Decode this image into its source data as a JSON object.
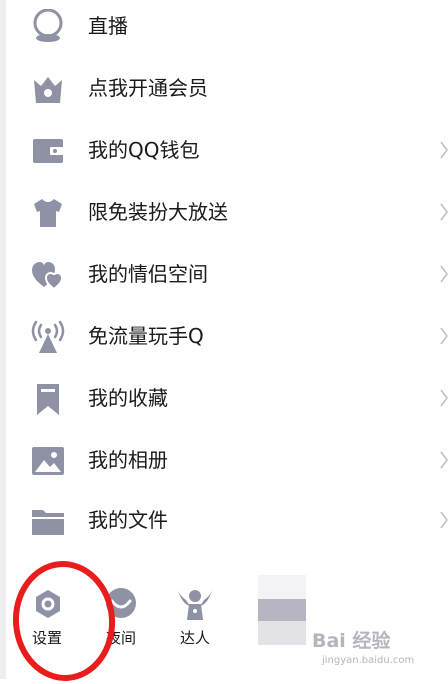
{
  "colors": {
    "icon": "#8f91a5",
    "chevron": "#c4c4c8",
    "highlight": "#ea1d1d"
  },
  "menu": {
    "items": [
      {
        "label": "直播",
        "icon": "live-icon"
      },
      {
        "label": "点我开通会员",
        "icon": "vip-crown-icon"
      },
      {
        "label": "我的QQ钱包",
        "icon": "wallet-icon"
      },
      {
        "label": "限免装扮大放送",
        "icon": "shirt-icon"
      },
      {
        "label": "我的情侣空间",
        "icon": "couple-hearts-icon"
      },
      {
        "label": "免流量玩手Q",
        "icon": "antenna-icon"
      },
      {
        "label": "我的收藏",
        "icon": "bookmark-icon"
      },
      {
        "label": "我的相册",
        "icon": "photo-album-icon"
      },
      {
        "label": "我的文件",
        "icon": "folder-icon"
      }
    ]
  },
  "bottom_bar": {
    "settings": {
      "label": "设置",
      "icon": "settings-hexagon-icon"
    },
    "night": {
      "label": "夜间",
      "icon": "night-mode-icon"
    },
    "expert": {
      "label": "达人",
      "icon": "expert-winged-icon"
    }
  },
  "watermark": {
    "text": "Bai 经验",
    "sub": "jingyan.baidu.com"
  }
}
